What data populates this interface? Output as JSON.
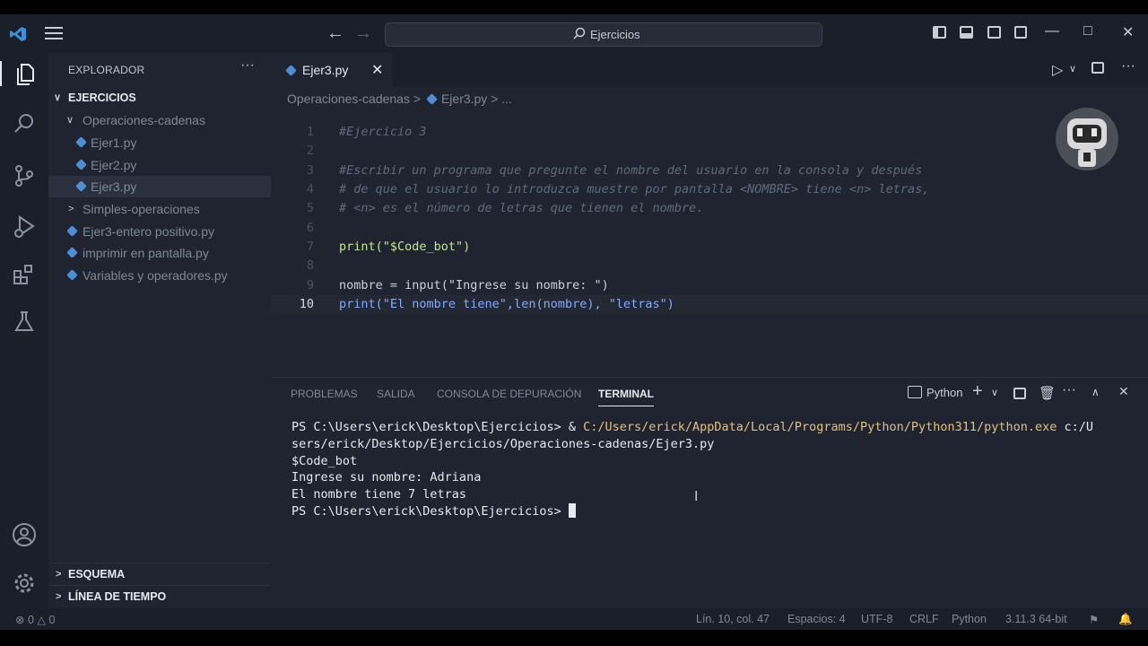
{
  "titlebar": {
    "search_text": "Ejercicios"
  },
  "sidebar": {
    "title": "EXPLORADOR",
    "root": "EJERCICIOS",
    "folder_open": "Operaciones-cadenas",
    "files_open": [
      "Ejer1.py",
      "Ejer2.py",
      "Ejer3.py"
    ],
    "folder_closed": "Simples-operaciones",
    "files_root": [
      "Ejer3-entero positivo.py",
      "imprimir en pantalla.py",
      "Variables y operadores.py"
    ],
    "outline": "ESQUEMA",
    "timeline": "LÍNEA DE TIEMPO"
  },
  "editor": {
    "tab_label": "Ejer3.py",
    "breadcrumb": "Operaciones-cadenas  >  Ejer3.py  >  ...",
    "breadcrumb_parts": [
      "Operaciones-cadenas",
      "Ejer3.py",
      "..."
    ],
    "line_numbers": [
      "1",
      "2",
      "3",
      "4",
      "5",
      "6",
      "7",
      "8",
      "9",
      "10"
    ],
    "lines": [
      "#Ejercicio 3",
      "",
      "#Escribir un programa que pregunte el nombre del usuario en la consola y después",
      "# de que el usuario lo introduzca muestre por pantalla <NOMBRE> tiene <n> letras,",
      "# <n> es el número de letras que tienen el nombre.",
      "",
      "print(\"$Code_bot\")",
      "",
      "nombre = input(\"Ingrese su nombre: \")",
      "print(\"El nombre tiene\",len(nombre), \"letras\")"
    ],
    "current_line": "10"
  },
  "panel": {
    "tabs": [
      "PROBLEMAS",
      "SALIDA",
      "CONSOLA DE DEPURACIÓN",
      "TERMINAL"
    ],
    "active_tab": "TERMINAL",
    "shell": "Python",
    "terminal": {
      "line1_prompt": "PS C:\\Users\\erick\\Desktop\\Ejercicios> & ",
      "line1_path": "C:/Users/erick/AppData/Local/Programs/Python/Python311/python.exe",
      "line1_arg": " c:/U",
      "line2": "sers/erick/Desktop/Ejercicios/Operaciones-cadenas/Ejer3.py",
      "line3": "$Code_bot",
      "line4": "Ingrese su nombre: Adriana",
      "line5": "El nombre tiene 7 letras",
      "line6": "PS C:\\Users\\erick\\Desktop\\Ejercicios> "
    }
  },
  "statusbar": {
    "errors": "0",
    "warnings": "0",
    "position": "Lín. 10, col. 47",
    "spaces": "Espacios: 4",
    "encoding": "UTF-8",
    "eol": "CRLF",
    "language": "Python",
    "version": "3.11.3 64-bit"
  },
  "colors": {
    "background": "#1f2430",
    "accent": "#4c8fd6",
    "string": "#c3e88d",
    "function": "#82aaff",
    "comment": "#5f6b7c"
  }
}
